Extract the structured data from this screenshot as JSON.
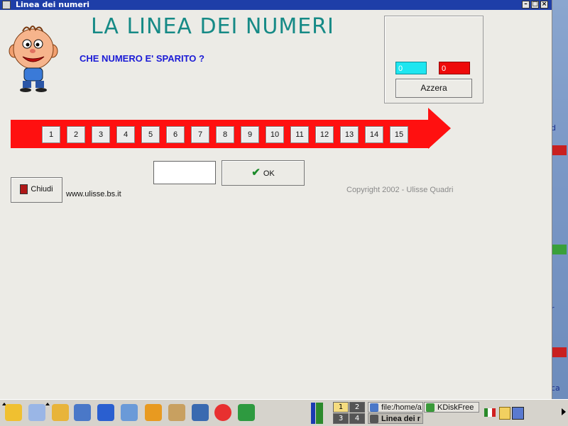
{
  "window": {
    "title": "Linea dei numeri"
  },
  "app": {
    "title": "LA LINEA DEI NUMERI",
    "question": "CHE NUMERO E' SPARITO ?",
    "website": "www.ulisse.bs.it",
    "copyright": "Copyright  2002  -  Ulisse Quadri"
  },
  "score": {
    "correct": "0",
    "wrong": "0",
    "reset_label": "Azzera"
  },
  "numbers": [
    "1",
    "2",
    "3",
    "4",
    "5",
    "6",
    "7",
    "8",
    "9",
    "10",
    "11",
    "12",
    "13",
    "14",
    "15"
  ],
  "answer": {
    "value": ""
  },
  "ok_label": "OK",
  "close_label": "Chiudi",
  "taskbar": {
    "pager": [
      "1",
      "2",
      "3",
      "4"
    ],
    "tasks": [
      "file:/home/a",
      "KDiskFree",
      "Linea dei r"
    ]
  },
  "desktop": {
    "fragments": [
      "d",
      "r",
      "ca"
    ]
  }
}
